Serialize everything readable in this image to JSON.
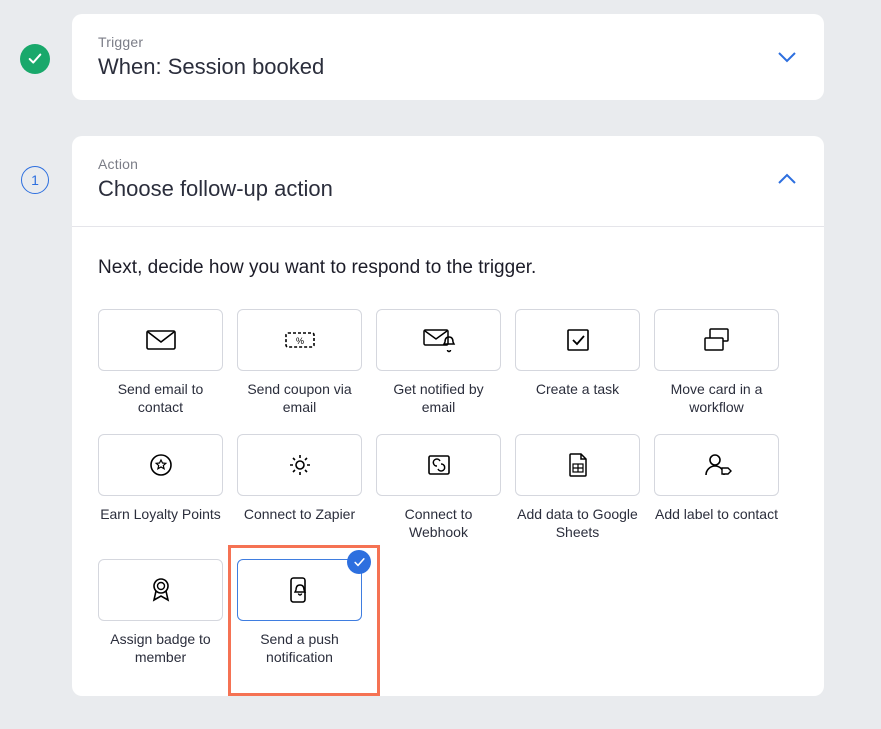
{
  "trigger": {
    "label": "Trigger",
    "title": "When: Session booked",
    "completed": true
  },
  "action": {
    "label": "Action",
    "title": "Choose follow-up action",
    "step_number": "1",
    "prompt": "Next, decide how you want to respond to the trigger.",
    "options": [
      {
        "id": "send-email",
        "label": "Send email to contact",
        "icon": "envelope-icon"
      },
      {
        "id": "send-coupon",
        "label": "Send coupon via email",
        "icon": "coupon-icon"
      },
      {
        "id": "notify-email",
        "label": "Get notified by email",
        "icon": "envelope-bell-icon"
      },
      {
        "id": "create-task",
        "label": "Create a task",
        "icon": "task-check-icon"
      },
      {
        "id": "move-card",
        "label": "Move card in a workflow",
        "icon": "workflow-card-icon"
      },
      {
        "id": "earn-points",
        "label": "Earn Loyalty Points",
        "icon": "star-circle-icon"
      },
      {
        "id": "connect-zapier",
        "label": "Connect to Zapier",
        "icon": "gear-icon"
      },
      {
        "id": "connect-webhook",
        "label": "Connect to Webhook",
        "icon": "webhook-icon"
      },
      {
        "id": "google-sheets",
        "label": "Add data to Google Sheets",
        "icon": "sheet-icon"
      },
      {
        "id": "add-label",
        "label": "Add label to contact",
        "icon": "label-contact-icon"
      },
      {
        "id": "assign-badge",
        "label": "Assign badge to member",
        "icon": "badge-icon"
      },
      {
        "id": "push-notification",
        "label": "Send a push notification",
        "icon": "phone-bell-icon",
        "selected": true,
        "highlighted": true
      }
    ]
  }
}
